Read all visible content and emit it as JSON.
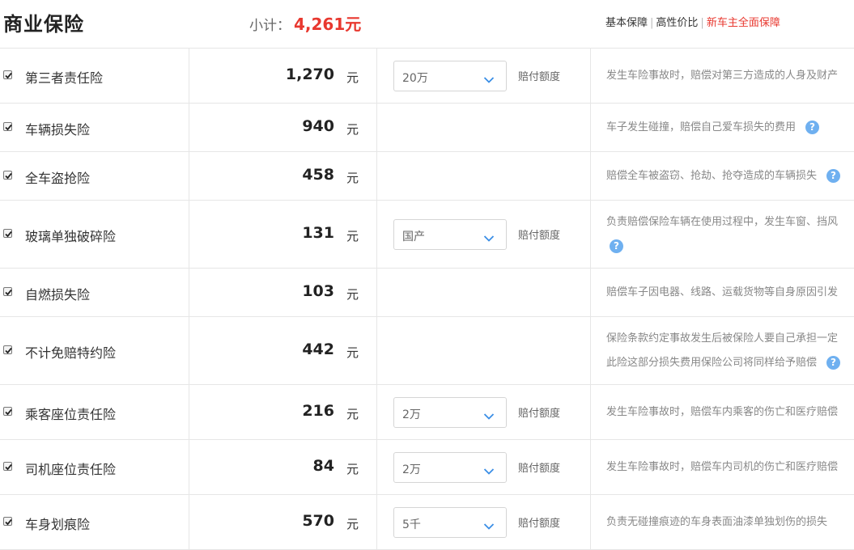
{
  "header": {
    "title": "商业保险",
    "subtotal_label": "小计：",
    "subtotal_value": "4,261元",
    "plans": [
      "基本保障",
      "高性价比",
      "新车主全面保障"
    ]
  },
  "unit": "元",
  "amount_label": "赔付额度",
  "help_glyph": "?",
  "colors": {
    "accent": "#e8382f",
    "help": "#6fb0f0"
  },
  "rows": [
    {
      "checked": true,
      "name": "第三者责任险",
      "price": "1,270",
      "select": "20万",
      "desc": [
        "发生车险事故时，赔偿对第三方造成的人身及财产"
      ]
    },
    {
      "checked": true,
      "name": "车辆损失险",
      "price": "940",
      "desc": [
        "车子发生碰撞，赔偿自己爱车损失的费用"
      ]
    },
    {
      "checked": true,
      "name": "全车盗抢险",
      "price": "458",
      "desc": [
        "赔偿全车被盗窃、抢劫、抢夺造成的车辆损失"
      ]
    },
    {
      "checked": true,
      "name": "玻璃单独破碎险",
      "price": "131",
      "select": "国产",
      "desc": [
        "负责赔偿保险车辆在使用过程中，发生车窗、挡风",
        ""
      ]
    },
    {
      "checked": true,
      "name": "自燃损失险",
      "price": "103",
      "desc": [
        "赔偿车子因电器、线路、运载货物等自身原因引发"
      ]
    },
    {
      "checked": true,
      "name": "不计免赔特约险",
      "price": "442",
      "desc": [
        "保险条款约定事故发生后被保险人要自己承担一定",
        "此险这部分损失费用保险公司将同样给予赔偿"
      ]
    },
    {
      "checked": true,
      "name": "乘客座位责任险",
      "price": "216",
      "select": "2万",
      "desc": [
        "发生车险事故时，赔偿车内乘客的伤亡和医疗赔偿"
      ]
    },
    {
      "checked": true,
      "name": "司机座位责任险",
      "price": "84",
      "select": "2万",
      "desc": [
        "发生车险事故时，赔偿车内司机的伤亡和医疗赔偿"
      ]
    },
    {
      "checked": true,
      "name": "车身划痕险",
      "price": "570",
      "select": "5千",
      "desc": [
        "负责无碰撞痕迹的车身表面油漆单独划伤的损失"
      ]
    }
  ]
}
